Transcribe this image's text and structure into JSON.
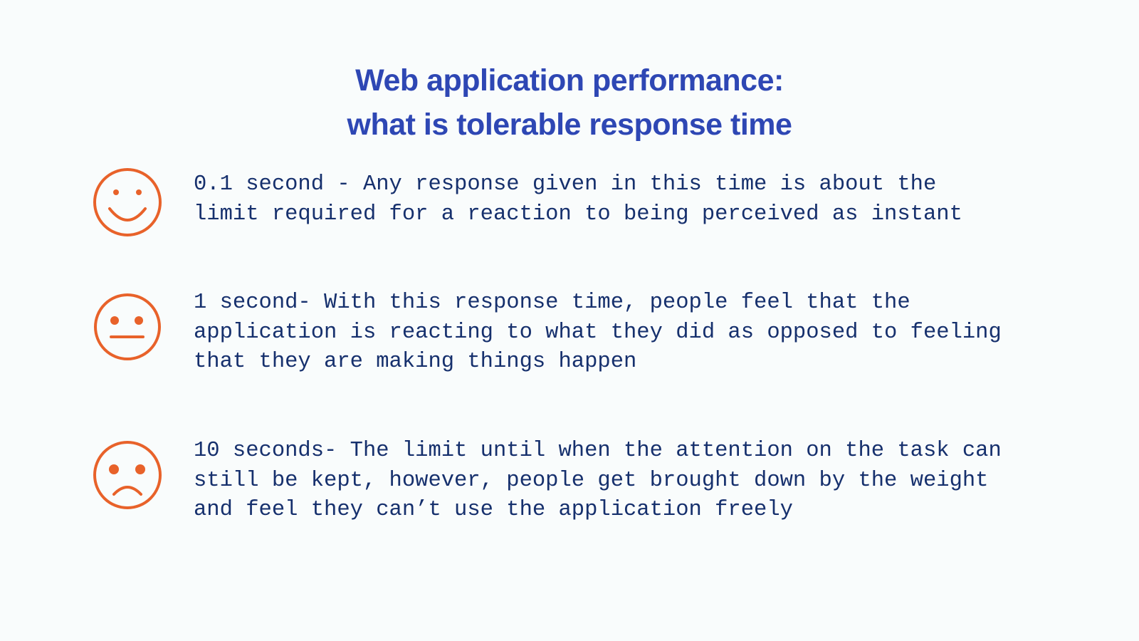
{
  "title": {
    "line1": "Web application performance:",
    "line2": "what is tolerable response time"
  },
  "colors": {
    "background": "#f9fcfc",
    "title": "#2e47b4",
    "text": "#16306d",
    "icon": "#e8622a"
  },
  "items": [
    {
      "icon": "happy-face-icon",
      "lines": [
        "0.1 second - Any response given in this time is about the",
        "limit required for a reaction to being perceived as instant"
      ]
    },
    {
      "icon": "neutral-face-icon",
      "lines": [
        "1 second- With this response time, people feel that the",
        "application is reacting to what they did as opposed to feeling",
        "that they are making things happen"
      ]
    },
    {
      "icon": "sad-face-icon",
      "lines": [
        "10 seconds- The limit until when the attention on the task can",
        "still be kept, however, people get brought down by the weight",
        "and feel they can’t use the application freely"
      ]
    }
  ]
}
